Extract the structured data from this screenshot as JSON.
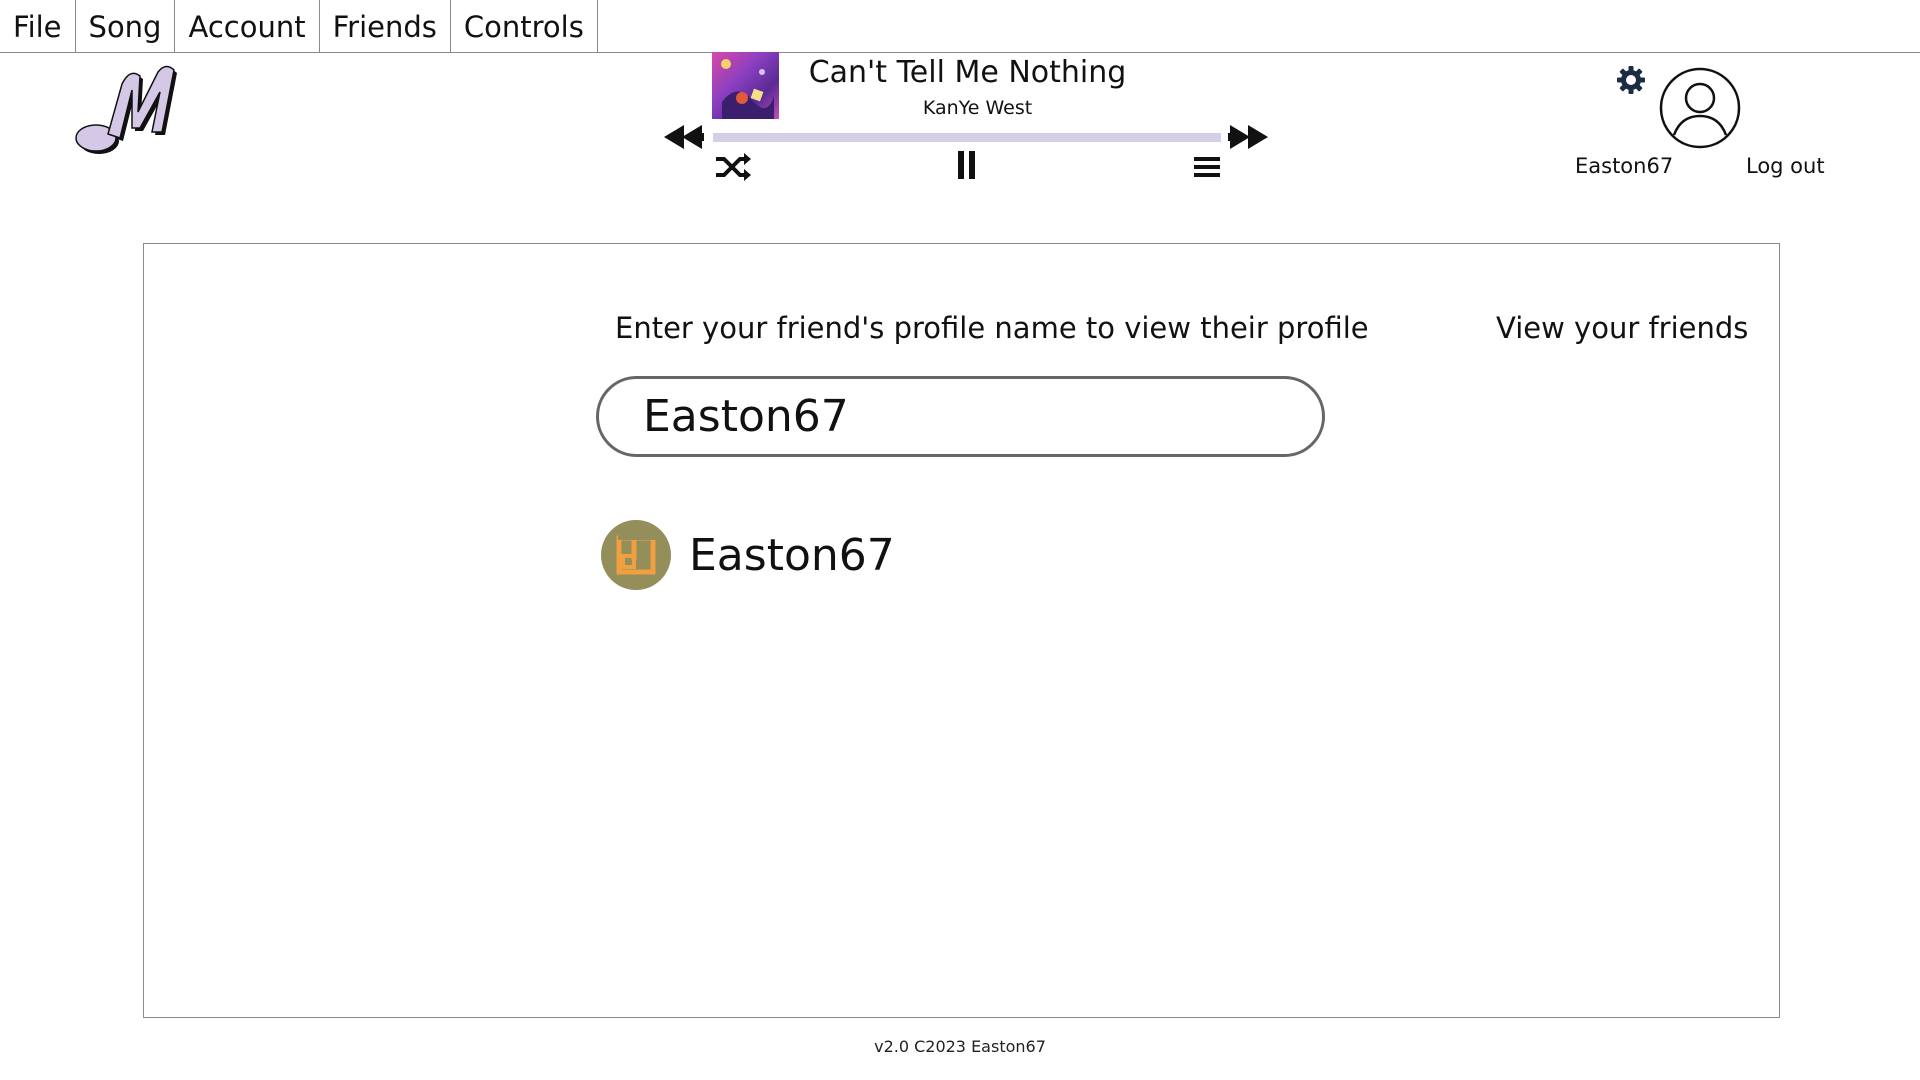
{
  "menu": {
    "items": [
      {
        "label": "File"
      },
      {
        "label": "Song"
      },
      {
        "label": "Account"
      },
      {
        "label": "Friends"
      },
      {
        "label": "Controls"
      }
    ]
  },
  "player": {
    "title": "Can't Tell Me Nothing",
    "artist": "KanYe West",
    "progress": 0.0
  },
  "account": {
    "username": "Easton67",
    "logout_label": "Log out"
  },
  "friends_page": {
    "prompt": "Enter your friend's profile name to view their profile",
    "view_friends_label": "View your friends",
    "search_value": "Easton67",
    "results": [
      {
        "name": "Easton67"
      }
    ]
  },
  "footer": {
    "text": "v2.0 C2023 Easton67"
  },
  "colors": {
    "accent": "#d6cde6",
    "logo": "#d4c8e6",
    "result_avatar": "#948e5a",
    "result_avatar_mark": "#f0a040"
  }
}
